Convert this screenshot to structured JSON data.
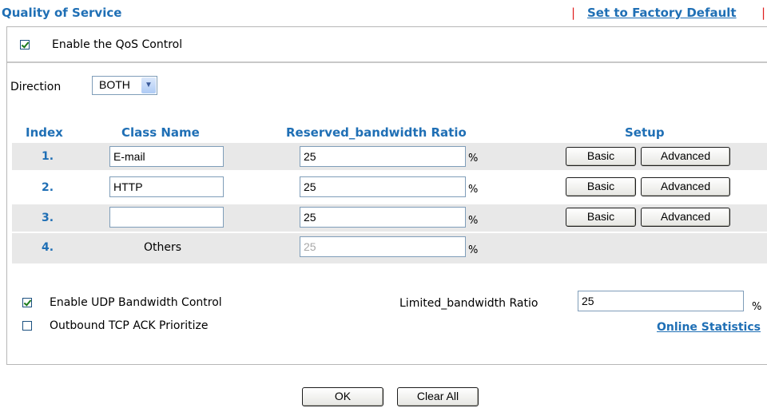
{
  "header": {
    "title": "Quality of Service",
    "separator": "|",
    "factory_default": "Set to Factory Default"
  },
  "qos": {
    "enable_label": "Enable the QoS Control",
    "enabled": true
  },
  "direction": {
    "label": "Direction",
    "value": "BOTH"
  },
  "table": {
    "headers": {
      "index": "Index",
      "class_name": "Class Name",
      "ratio": "Reserved_bandwidth Ratio",
      "setup": "Setup"
    },
    "rows": [
      {
        "index": "1.",
        "class_name": "E-mail",
        "ratio": "25",
        "unit": "%",
        "basic": "Basic",
        "advanced": "Advanced"
      },
      {
        "index": "2.",
        "class_name": "HTTP",
        "ratio": "25",
        "unit": "%",
        "basic": "Basic",
        "advanced": "Advanced"
      },
      {
        "index": "3.",
        "class_name": "",
        "ratio": "25",
        "unit": "%",
        "basic": "Basic",
        "advanced": "Advanced"
      },
      {
        "index": "4.",
        "class_name": "Others",
        "ratio": "25",
        "unit": "%"
      }
    ]
  },
  "udp": {
    "label": "Enable UDP Bandwidth Control",
    "enabled": true,
    "limit_label": "Limited_bandwidth Ratio",
    "limit_value": "25",
    "unit": "%"
  },
  "tcp_ack": {
    "label": "Outbound TCP ACK Prioritize",
    "enabled": false
  },
  "online_stats": "Online Statistics",
  "buttons": {
    "ok": "OK",
    "clear_all": "Clear All"
  }
}
